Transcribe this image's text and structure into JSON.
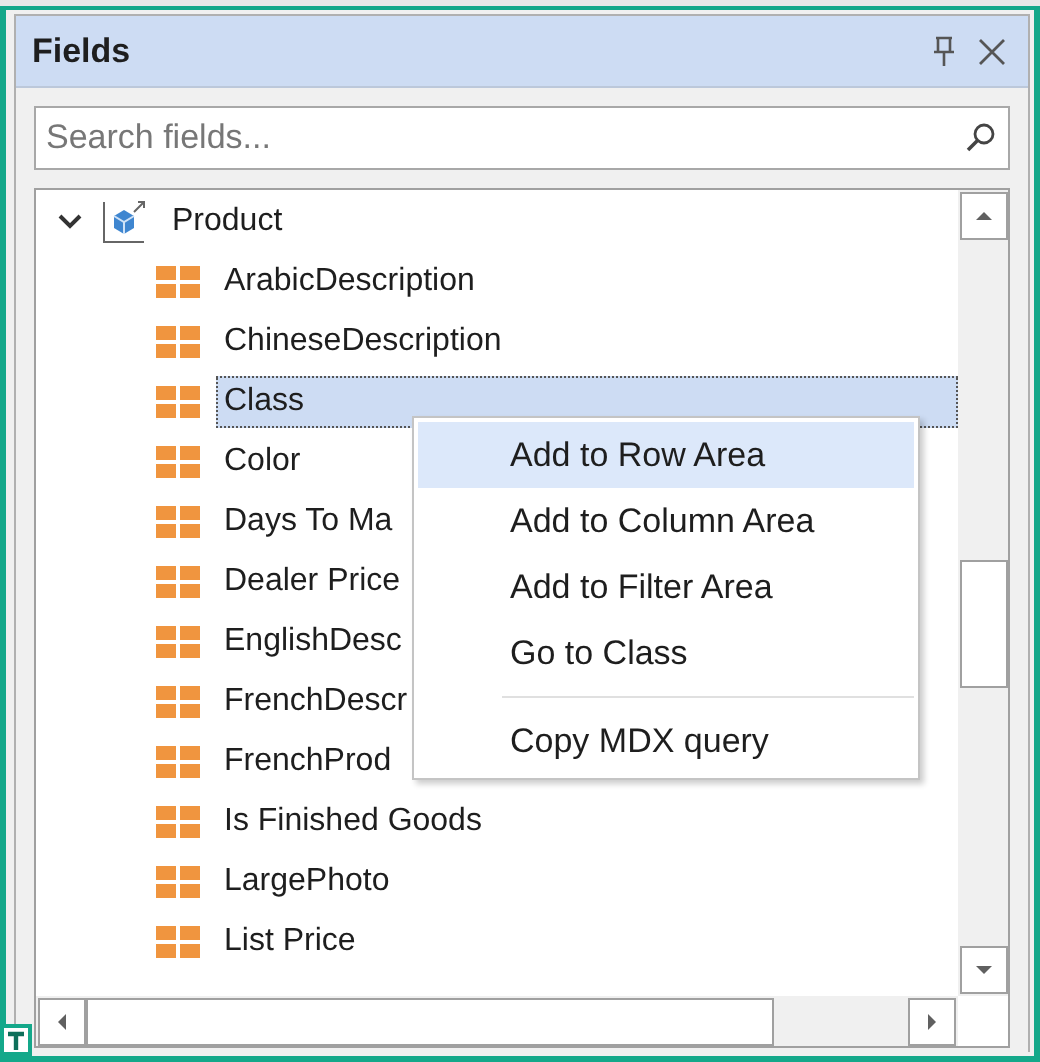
{
  "panel": {
    "title": "Fields",
    "search": {
      "placeholder": "Search fields..."
    },
    "tree": [
      {
        "label": "Product",
        "expanded": true,
        "children": [
          {
            "label": "ArabicDescription",
            "selected": false
          },
          {
            "label": "ChineseDescription",
            "selected": false
          },
          {
            "label": "Class",
            "selected": true
          },
          {
            "label": "Color",
            "selected": false
          },
          {
            "label": "Days To Ma",
            "selected": false
          },
          {
            "label": "Dealer Price",
            "selected": false
          },
          {
            "label": "EnglishDesc",
            "selected": false
          },
          {
            "label": "FrenchDescr",
            "selected": false
          },
          {
            "label": "FrenchProd",
            "selected": false
          },
          {
            "label": "Is Finished Goods",
            "selected": false
          },
          {
            "label": "LargePhoto",
            "selected": false
          },
          {
            "label": "List Price",
            "selected": false
          }
        ]
      }
    ]
  },
  "context_menu": {
    "items": [
      {
        "kind": "item",
        "label": "Add to Row Area",
        "highlighted": true
      },
      {
        "kind": "item",
        "label": "Add to Column Area",
        "highlighted": false
      },
      {
        "kind": "item",
        "label": "Add to Filter Area",
        "highlighted": false
      },
      {
        "kind": "item",
        "label": "Go to Class",
        "highlighted": false
      },
      {
        "kind": "separator"
      },
      {
        "kind": "item",
        "label": "Copy MDX query",
        "highlighted": false
      }
    ]
  }
}
